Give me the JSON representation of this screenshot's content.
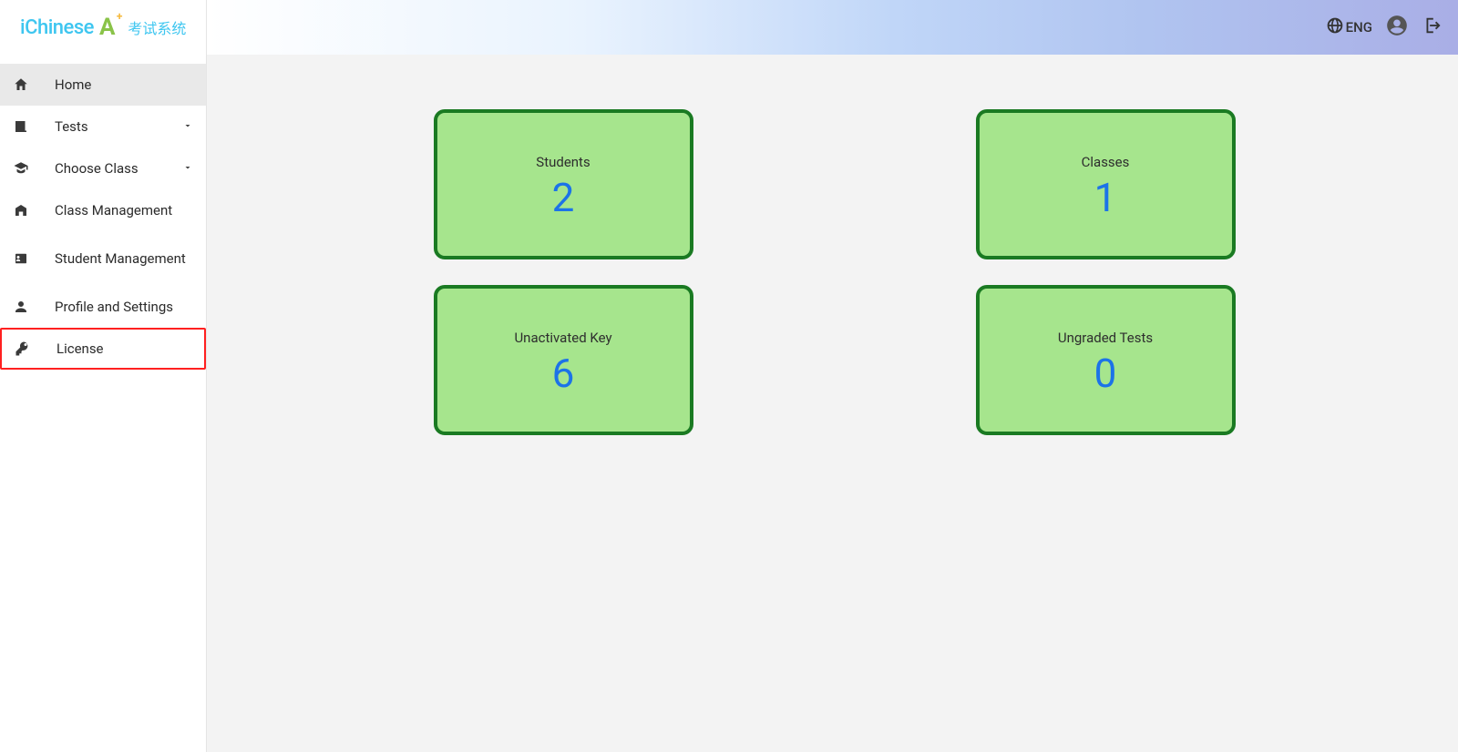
{
  "brand": {
    "name": "iChinese",
    "badge": "A",
    "plus": "+",
    "suffix": "考试系统"
  },
  "header": {
    "lang_label": "ENG"
  },
  "sidebar": {
    "items": [
      {
        "label": "Home",
        "icon": "home",
        "expandable": false,
        "active": true,
        "highlighted": false
      },
      {
        "label": "Tests",
        "icon": "book",
        "expandable": true,
        "active": false,
        "highlighted": false
      },
      {
        "label": "Choose Class",
        "icon": "cap",
        "expandable": true,
        "active": false,
        "highlighted": false
      },
      {
        "label": "Class Management",
        "icon": "building",
        "expandable": false,
        "active": false,
        "highlighted": false
      },
      {
        "label": "Student Management",
        "icon": "id",
        "expandable": false,
        "active": false,
        "highlighted": false
      },
      {
        "label": "Profile and Settings",
        "icon": "person",
        "expandable": false,
        "active": false,
        "highlighted": false
      },
      {
        "label": "License",
        "icon": "key",
        "expandable": false,
        "active": false,
        "highlighted": true
      }
    ]
  },
  "dashboard": {
    "cards": [
      {
        "title": "Students",
        "value": "2"
      },
      {
        "title": "Classes",
        "value": "1"
      },
      {
        "title": "Unactivated Key",
        "value": "6"
      },
      {
        "title": "Ungraded Tests",
        "value": "0"
      }
    ]
  }
}
